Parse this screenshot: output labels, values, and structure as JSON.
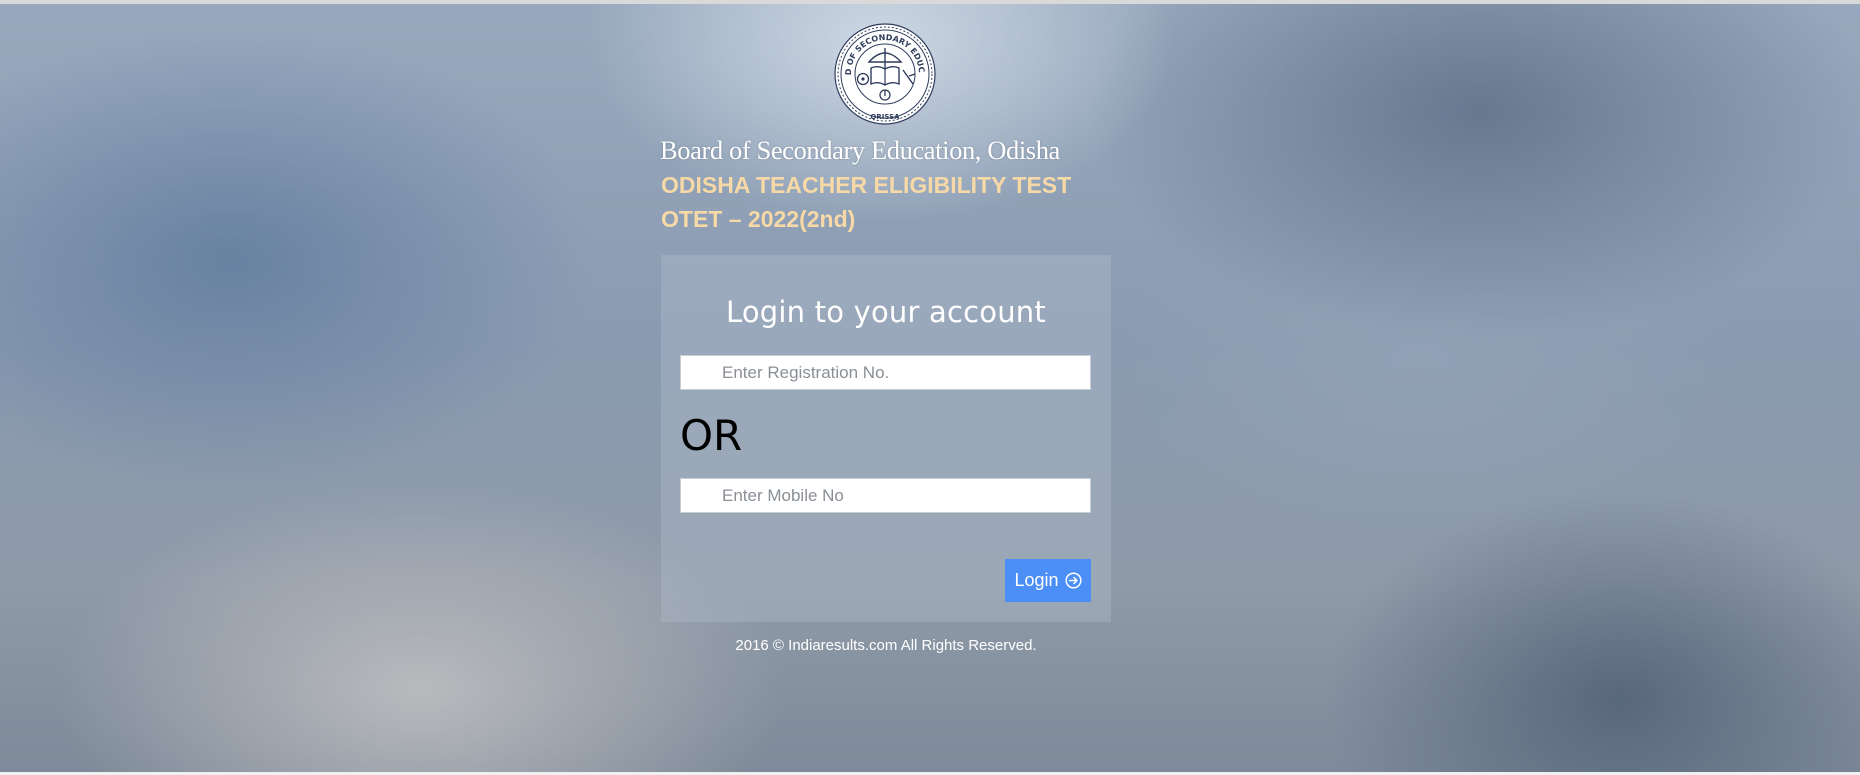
{
  "header": {
    "logo_icon": "bse-odisha-emblem-icon",
    "logo_text_top": "BOARD OF SECONDARY EDUCATION",
    "logo_text_bottom": "ORISSA",
    "org_name": "Board of Secondary Education, Odisha",
    "exam_title": "ODISHA TEACHER ELIGIBILITY TEST",
    "exam_subtitle": "OTET – 2022(2nd)"
  },
  "login": {
    "heading": "Login to your account",
    "registration_placeholder": "Enter Registration No.",
    "registration_value": "",
    "separator": "OR",
    "mobile_placeholder": "Enter Mobile No",
    "mobile_value": "",
    "button_label": "Login",
    "button_icon": "arrow-circle-right-icon"
  },
  "footer": {
    "copyright": "2016 © Indiaresults.com All Rights Reserved."
  },
  "colors": {
    "accent": "#4a8ef6",
    "exam_title": "#f6d9a6"
  }
}
